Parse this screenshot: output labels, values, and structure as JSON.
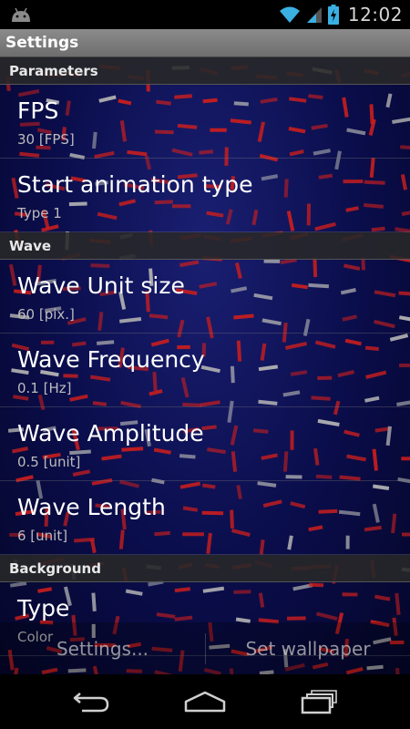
{
  "status_bar": {
    "time": "12:02",
    "icons": [
      "android-icon",
      "wifi-icon",
      "signal-icon",
      "battery-charging-icon"
    ]
  },
  "app": {
    "title": "Settings"
  },
  "sections": [
    {
      "header": "Parameters",
      "items": [
        {
          "title": "FPS",
          "summary": "30 [FPS]"
        },
        {
          "title": "Start animation type",
          "summary": "Type 1"
        }
      ]
    },
    {
      "header": "Wave",
      "items": [
        {
          "title": "Wave Unit size",
          "summary": "60 [pix.]"
        },
        {
          "title": "Wave Frequency",
          "summary": "0.1 [Hz]"
        },
        {
          "title": "Wave Amplitude",
          "summary": "0.5 [unit]"
        },
        {
          "title": "Wave Length",
          "summary": "6 [unit]"
        }
      ]
    },
    {
      "header": "Background",
      "items": [
        {
          "title": "Type",
          "summary": "Color"
        }
      ]
    }
  ],
  "wallpaper_actions": {
    "settings_label": "Settings...",
    "set_wallpaper_label": "Set wallpaper"
  },
  "nav_bar": {
    "icons": [
      "back-icon",
      "home-icon",
      "recent-apps-icon"
    ]
  },
  "colors": {
    "wallpaper_bg": "#0a0d4a",
    "wallpaper_dash_red": "#c81e1e",
    "wallpaper_dash_gray": "#b4b4b4",
    "category_bg": "#282828",
    "status_icon_blue": "#3ab0e2"
  }
}
